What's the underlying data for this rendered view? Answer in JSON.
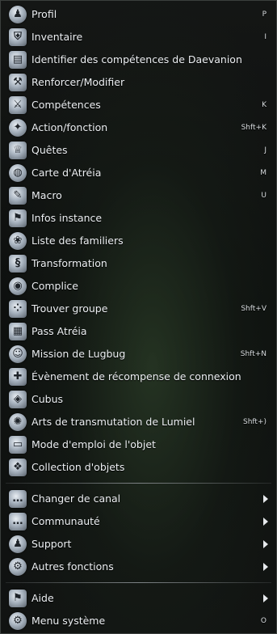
{
  "menu": {
    "items": [
      {
        "label": "Profil",
        "shortcut": "P",
        "icon": "person-icon",
        "glyph": "♟"
      },
      {
        "label": "Inventaire",
        "shortcut": "I",
        "icon": "shield-icon",
        "glyph": "⛨"
      },
      {
        "label": "Identifier des compétences de Daevanion",
        "shortcut": "",
        "icon": "book-icon",
        "glyph": "▤"
      },
      {
        "label": "Renforcer/Modifier",
        "shortcut": "",
        "icon": "anvil-icon",
        "glyph": "⚒"
      },
      {
        "label": "Compétences",
        "shortcut": "K",
        "icon": "crossed-swords-icon",
        "glyph": "⚔"
      },
      {
        "label": "Action/fonction",
        "shortcut": "Shft+K",
        "icon": "star-icon",
        "glyph": "✦"
      },
      {
        "label": "Quêtes",
        "shortcut": "J",
        "icon": "goblet-icon",
        "glyph": "♕"
      },
      {
        "label": "Carte d'Atréia",
        "shortcut": "M",
        "icon": "globe-icon",
        "glyph": "◍"
      },
      {
        "label": "Macro",
        "shortcut": "U",
        "icon": "quill-icon",
        "glyph": "✎"
      },
      {
        "label": "Infos instance",
        "shortcut": "",
        "icon": "flag-icon",
        "glyph": "⚑"
      },
      {
        "label": "Liste des familiers",
        "shortcut": "",
        "icon": "paw-icon",
        "glyph": "❀"
      },
      {
        "label": "Transformation",
        "shortcut": "",
        "icon": "scroll-icon",
        "glyph": "§"
      },
      {
        "label": "Complice",
        "shortcut": "",
        "icon": "shell-icon",
        "glyph": "◉"
      },
      {
        "label": "Trouver groupe",
        "shortcut": "Shft+V",
        "icon": "group-icon",
        "glyph": "⁘"
      },
      {
        "label": "Pass Atréia",
        "shortcut": "",
        "icon": "calendar-icon",
        "glyph": "▦"
      },
      {
        "label": "Mission de Lugbug",
        "shortcut": "Shft+N",
        "icon": "lugbug-icon",
        "glyph": "☺"
      },
      {
        "label": "Évènement de récompense de connexion",
        "shortcut": "",
        "icon": "gift-icon",
        "glyph": "✚"
      },
      {
        "label": "Cubus",
        "shortcut": "",
        "icon": "cube-icon",
        "glyph": "◈"
      },
      {
        "label": "Arts de transmutation de Lumiel",
        "shortcut": "Shft+)",
        "icon": "transmutation-icon",
        "glyph": "✺"
      },
      {
        "label": "Mode d'emploi de l'objet",
        "shortcut": "",
        "icon": "chest-icon",
        "glyph": "▭"
      },
      {
        "label": "Collection d'objets",
        "shortcut": "",
        "icon": "collection-icon",
        "glyph": "❖"
      }
    ],
    "submenus": [
      {
        "label": "Changer de canal",
        "icon": "chat-bubble-icon",
        "glyph": "…"
      },
      {
        "label": "Communauté",
        "icon": "chat-bubble-icon",
        "glyph": "…"
      },
      {
        "label": "Support",
        "icon": "person-icon",
        "glyph": "♟"
      },
      {
        "label": "Autres fonctions",
        "icon": "gears-icon",
        "glyph": "⚙"
      }
    ],
    "bottom": [
      {
        "label": "Aide",
        "shortcut": "",
        "icon": "flag-icon",
        "glyph": "⚑",
        "submenu": true
      },
      {
        "label": "Menu système",
        "shortcut": "O",
        "icon": "gear-icon",
        "glyph": "⚙",
        "submenu": false
      }
    ]
  }
}
